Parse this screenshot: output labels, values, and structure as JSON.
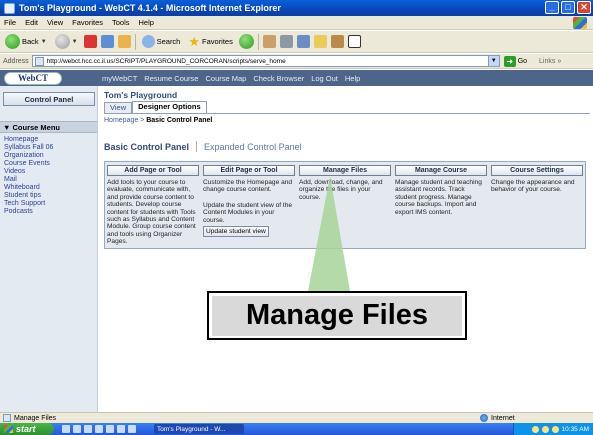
{
  "window": {
    "title": "Tom's Playground - WebCT 4.1.4 - Microsoft Internet Explorer"
  },
  "menubar": [
    "File",
    "Edit",
    "View",
    "Favorites",
    "Tools",
    "Help"
  ],
  "toolbar": {
    "back": "Back",
    "search": "Search",
    "favorites": "Favorites"
  },
  "address": {
    "label": "Address",
    "url": "http://webct.hcc.cc.il.us/SCRIPT/PLAYGROUND_CORCORAN/scripts/serve_home",
    "go": "Go",
    "links": "Links »"
  },
  "webct": {
    "logo": "WebCT",
    "nav": [
      "myWebCT",
      "Resume Course",
      "Course Map",
      "Check Browser",
      "Log Out",
      "Help"
    ]
  },
  "left": {
    "control_panel": "Control Panel",
    "course_menu": "▼ Course Menu",
    "items": [
      "Homepage",
      "Syllabus Fall 06",
      "Organization",
      "Course Events",
      "Videos",
      "Mail",
      "Whiteboard",
      "Student tips",
      "Tech Support",
      "Podcasts"
    ]
  },
  "main": {
    "course_title": "Tom's Playground",
    "tab_view": "View",
    "tab_designer": "Designer Options",
    "breadcrumb_home": "Homepage",
    "breadcrumb_sep": " > ",
    "breadcrumb_current": "Basic Control Panel",
    "panel_basic": "Basic Control Panel",
    "panel_expanded": "Expanded Control Panel",
    "columns": [
      {
        "head": "Add Page or Tool",
        "text": "Add tools to your course to evaluate, communicate with, and provide course content to students. Develop course content for students with Tools such as Syllabus and Content Module. Group course content and tools using Organizer Pages."
      },
      {
        "head": "Edit Page or Tool",
        "text": "Customize the Homepage and change course content.",
        "text2": "Update the student view of the Content Modules in your course.",
        "button": "Update student view"
      },
      {
        "head": "Manage Files",
        "text": "Add, download, change, and organize the files in your course."
      },
      {
        "head": "Manage Course",
        "text": "Manage student and teaching assistant records. Track student progress. Manage course backups. Import and export IMS content."
      },
      {
        "head": "Course Settings",
        "text": "Change the appearance and behavior of your course."
      }
    ]
  },
  "callout": {
    "label": "Manage Files"
  },
  "status": {
    "left": "Manage Files",
    "zone": "Internet"
  },
  "taskbar": {
    "start": "start",
    "task": "Tom's Playground - W...",
    "clock": "10:35 AM"
  }
}
